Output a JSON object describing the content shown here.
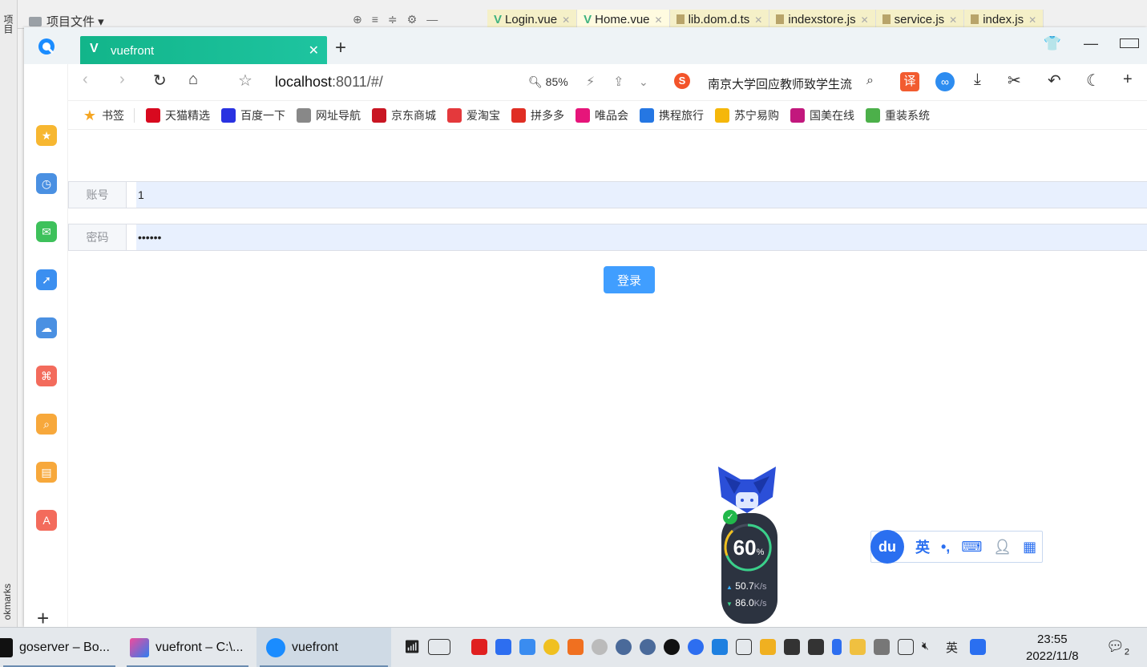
{
  "ide": {
    "project_label": "项目文件",
    "tabs": [
      "Login.vue",
      "Home.vue",
      "lib.dom.d.ts",
      "indexstore.js",
      "service.js",
      "index.js"
    ],
    "left_vertical_top": "项目",
    "left_vertical_bottom": "okmarks"
  },
  "browser": {
    "tab_title": "vuefront",
    "url_host": "localhost",
    "url_rest": ":8011/#/",
    "zoom": "85%",
    "search_text": "南京大学回应教师致学生流",
    "translate_label": "译"
  },
  "bookmarks": [
    {
      "label": "书签",
      "icon": "star-icon",
      "color": "#f5a623"
    },
    {
      "label": "天猫精选",
      "icon": "tmall-icon",
      "color": "#d8091f"
    },
    {
      "label": "百度一下",
      "icon": "baidu-icon",
      "color": "#2932e1"
    },
    {
      "label": "网址导航",
      "icon": "globe-icon",
      "color": "#888888"
    },
    {
      "label": "京东商城",
      "icon": "jd-icon",
      "color": "#c91623"
    },
    {
      "label": "爱淘宝",
      "icon": "taobao-icon",
      "color": "#e4393c"
    },
    {
      "label": "拼多多",
      "icon": "pdd-icon",
      "color": "#e02e24"
    },
    {
      "label": "唯品会",
      "icon": "vip-icon",
      "color": "#e6157a"
    },
    {
      "label": "携程旅行",
      "icon": "ctrip-icon",
      "color": "#2577e3"
    },
    {
      "label": "苏宁易购",
      "icon": "suning-icon",
      "color": "#f5b70a"
    },
    {
      "label": "国美在线",
      "icon": "gome-icon",
      "color": "#c2187d"
    },
    {
      "label": "重装系统",
      "icon": "reinstall-icon",
      "color": "#4cb04a"
    }
  ],
  "sidebar_icons": [
    {
      "name": "favorites-icon",
      "color": "#f7b731"
    },
    {
      "name": "history-icon",
      "color": "#4a90e2"
    },
    {
      "name": "wechat-icon",
      "color": "#3ec15b"
    },
    {
      "name": "send-icon",
      "color": "#3b8ff0"
    },
    {
      "name": "cloud-icon",
      "color": "#4a90e2"
    },
    {
      "name": "pdf-icon",
      "color": "#f36b5c"
    },
    {
      "name": "search-icon",
      "color": "#f7a83b"
    },
    {
      "name": "reader-icon",
      "color": "#f7a83b"
    },
    {
      "name": "translate-icon",
      "color": "#f36b5c"
    }
  ],
  "form": {
    "account_label": "账号",
    "account_value": "1",
    "password_label": "密码",
    "password_value": "••••••",
    "login_button": "登录"
  },
  "widget": {
    "percent": "60",
    "percent_unit": "%",
    "up_speed": "50.7",
    "down_speed": "86.0",
    "speed_unit": "K/s"
  },
  "ime": {
    "logo": "du",
    "lang": "英",
    "punct": "•,"
  },
  "taskbar": {
    "tasks": [
      "goserver – Bo...",
      "vuefront – C:\\...",
      "vuefront"
    ],
    "time": "23:55",
    "date": "2022/11/8",
    "ime_lang": "英",
    "notifications": "2"
  }
}
